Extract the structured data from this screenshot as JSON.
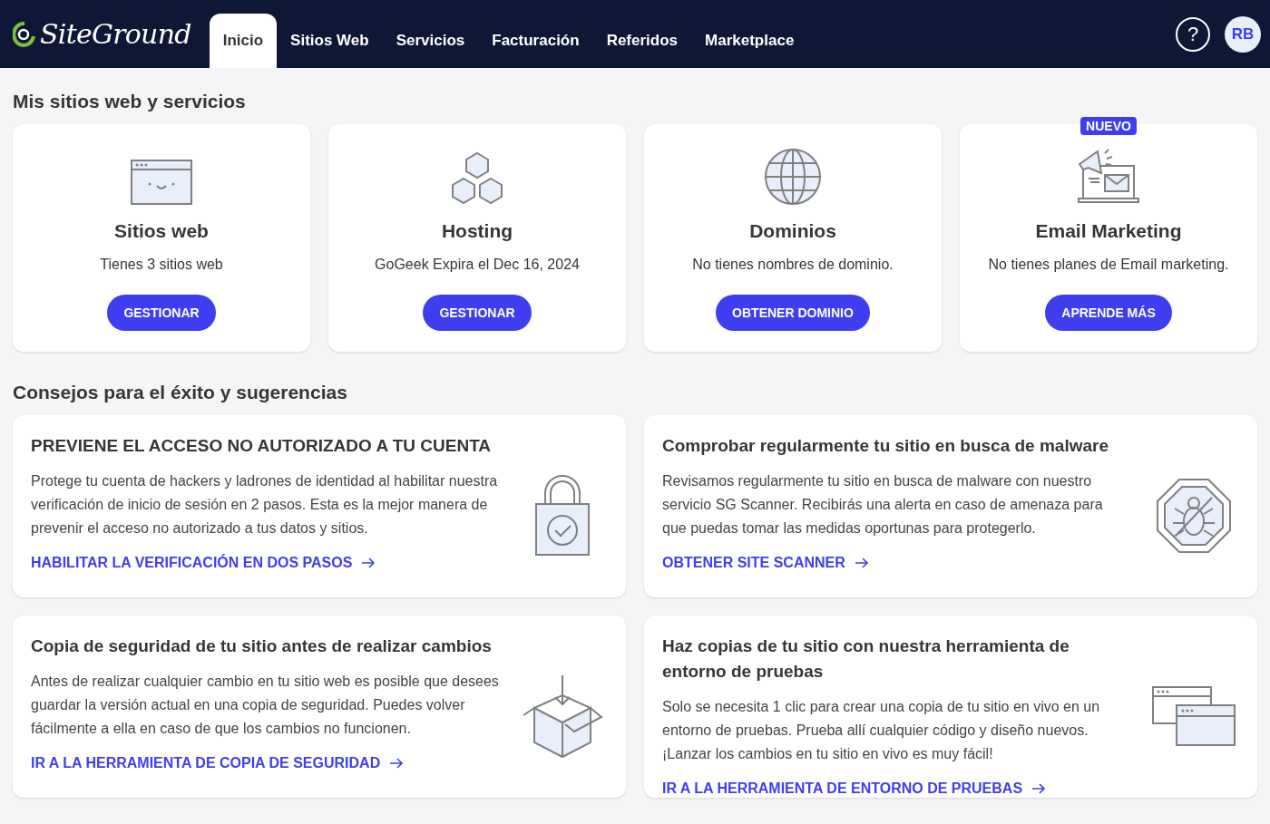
{
  "nav": {
    "logo": "SiteGround",
    "tabs": [
      {
        "label": "Inicio",
        "selected": true
      },
      {
        "label": "Sitios Web",
        "selected": false
      },
      {
        "label": "Servicios",
        "selected": false
      },
      {
        "label": "Facturación",
        "selected": false
      },
      {
        "label": "Referidos",
        "selected": false
      },
      {
        "label": "Marketplace",
        "selected": false
      }
    ],
    "help": "?",
    "avatar": "RB"
  },
  "services": {
    "heading": "Mis sitios web y servicios",
    "cards": [
      {
        "title": "Sitios web",
        "text": "Tienes 3 sitios web",
        "button": "GESTIONAR"
      },
      {
        "title": "Hosting",
        "text": "GoGeek Expira el Dec 16, 2024",
        "button": "GESTIONAR"
      },
      {
        "title": "Dominios",
        "text": "No tienes nombres de dominio.",
        "button": "OBTENER DOMINIO"
      },
      {
        "title": "Email Marketing",
        "text": "No tienes planes de Email marketing.",
        "button": "APRENDE MÁS",
        "badge": "NUEVO"
      }
    ]
  },
  "tips": {
    "heading": "Consejos para el éxito y sugerencias",
    "cards": [
      {
        "title": "PREVIENE EL ACCESO NO AUTORIZADO A TU CUENTA",
        "text": "Protege tu cuenta de hackers y ladrones de identidad al habilitar nuestra verificación de inicio de sesión en 2 pasos. Esta es la mejor manera de prevenir el acceso no autorizado a tus datos y sitios.",
        "link": "HABILITAR LA VERIFICACIÓN EN DOS PASOS"
      },
      {
        "title": "Comprobar regularmente tu sitio en busca de malware",
        "text": "Revisamos regularmente tu sitio en busca de malware con nuestro servicio SG Scanner. Recibirás una alerta en caso de amenaza para que puedas tomar las medidas oportunas para protegerlo.",
        "link": "OBTENER SITE SCANNER"
      },
      {
        "title": "Copia de seguridad de tu sitio antes de realizar cambios",
        "text": "Antes de realizar cualquier cambio en tu sitio web es posible que desees guardar la versión actual en una copia de seguridad. Puedes volver fácilmente a ella en caso de que los cambios no funcionen.",
        "link": "IR A LA HERRAMIENTA DE COPIA DE SEGURIDAD"
      },
      {
        "title": "Haz copias de tu sitio con nuestra herramienta de entorno de pruebas",
        "text": "Solo se necesita 1 clic para crear una copia de tu sitio en vivo en un entorno de pruebas. Prueba allí cualquier código y diseño nuevos. ¡Lanzar los cambios en tu sitio en vivo es muy fácil!",
        "link": "IR A LA HERRAMIENTA DE ENTORNO DE PRUEBAS"
      }
    ]
  }
}
